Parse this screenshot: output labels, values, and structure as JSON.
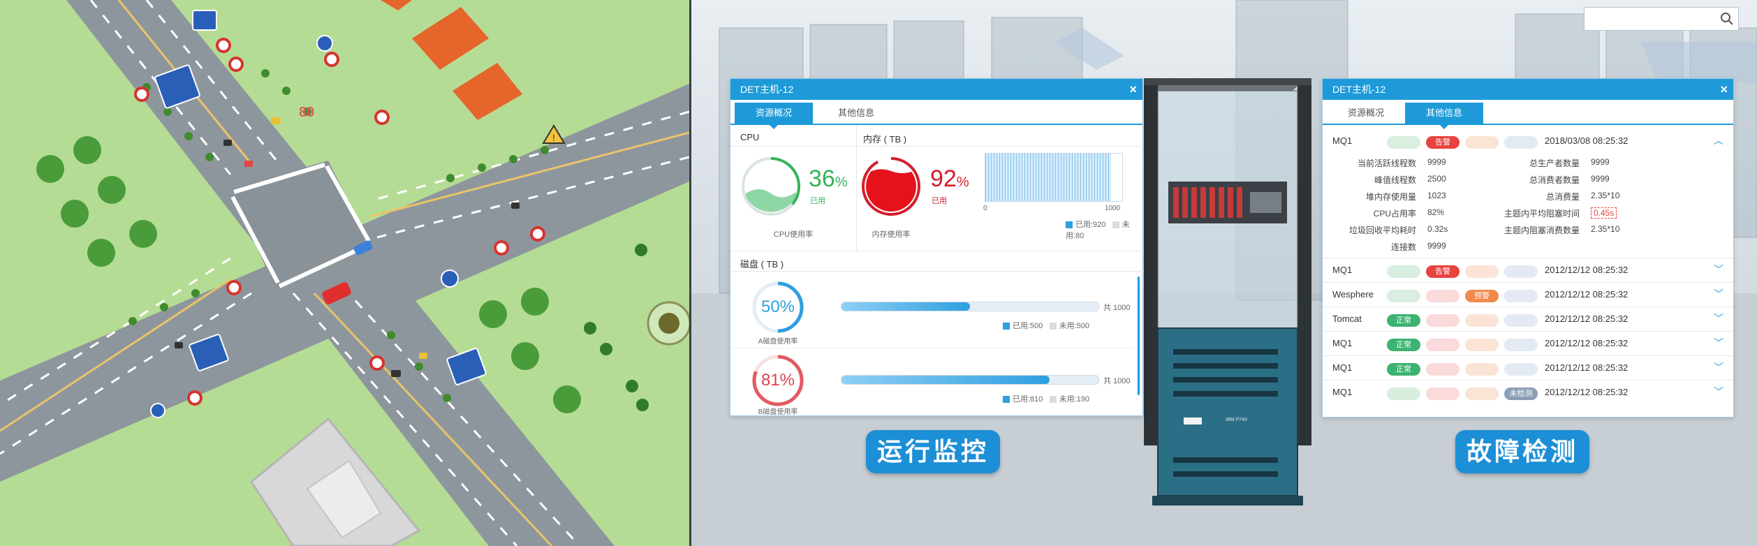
{
  "search": {
    "placeholder": "",
    "value": ""
  },
  "map": {
    "speed_sign": "80",
    "warning_sign": "!"
  },
  "monitor_panel": {
    "title": "DET主机-12",
    "close": "×",
    "tabs": [
      "资源概况",
      "其他信息"
    ],
    "active_tab": 0,
    "cpu": {
      "title": "CPU",
      "percent": "36",
      "pct_sign": "%",
      "used_label": "已用",
      "caption": "CPU使用率",
      "value": 36
    },
    "memory": {
      "title": "内存 ( TB )",
      "percent": "92",
      "pct_sign": "%",
      "used_label": "已用",
      "caption": "内存使用率",
      "value": 92,
      "axis_min": "0",
      "axis_max": "1000",
      "legend_used": "已用:920",
      "legend_unused": "未用:80"
    },
    "disk": {
      "title": "磁盘 ( TB )",
      "items": [
        {
          "percent": "50%",
          "caption": "A磁盘使用率",
          "total": "共 1000",
          "used": "已用:500",
          "unused": "未用:500",
          "value": 50
        },
        {
          "percent": "81%",
          "caption": "B磁盘使用率",
          "total": "共 1000",
          "used": "已用:810",
          "unused": "未用:190",
          "value": 81
        }
      ]
    }
  },
  "fault_panel": {
    "title": "DET主机-12",
    "close": "×",
    "tabs": [
      "资源概况",
      "其他信息"
    ],
    "active_tab": 1,
    "expanded": {
      "name": "MQ1",
      "badge": "告警",
      "date": "2018/03/08  08:25:32",
      "left_keys": [
        "当前活跃线程数",
        "峰值线程数",
        "堆内存使用量",
        "CPU占用率",
        "垃圾回收平均耗时",
        "连接数"
      ],
      "left_vals": [
        "9999",
        "2500",
        "1023",
        "82%",
        "0.32s",
        "9999"
      ],
      "right_keys": [
        "总生产者数量",
        "总消费者数量",
        "总消费量",
        "主题内平均阻塞时间",
        "主题内阻塞消费数量"
      ],
      "right_vals": [
        "9999",
        "9999",
        "2.35*10",
        "0.45s",
        "2.35*10"
      ]
    },
    "rows": [
      {
        "name": "MQ1",
        "badge": "告警",
        "slot": 1,
        "date": "2012/12/12  08:25:32"
      },
      {
        "name": "Wesphere",
        "badge": "预警",
        "slot": 2,
        "date": "2012/12/12  08:25:32"
      },
      {
        "name": "Tomcat",
        "badge": "正常",
        "slot": 0,
        "date": "2012/12/12  08:25:32"
      },
      {
        "name": "MQ1",
        "badge": "正常",
        "slot": 0,
        "date": "2012/12/12  08:25:32"
      },
      {
        "name": "MQ1",
        "badge": "正常",
        "slot": 0,
        "date": "2012/12/12  08:25:32"
      },
      {
        "name": "MQ1",
        "badge": "未检测",
        "slot": 3,
        "date": "2012/12/12  08:25:32"
      }
    ]
  },
  "rack": {
    "label": "IBM P740"
  },
  "buttons": {
    "monitor": "运行监控",
    "fault": "故障检测"
  },
  "colors": {
    "accent": "#1e9ad9",
    "normal": "#3cb371",
    "alarm": "#e8433f",
    "warning": "#f08a4b",
    "unchecked": "#8a9fb6"
  }
}
